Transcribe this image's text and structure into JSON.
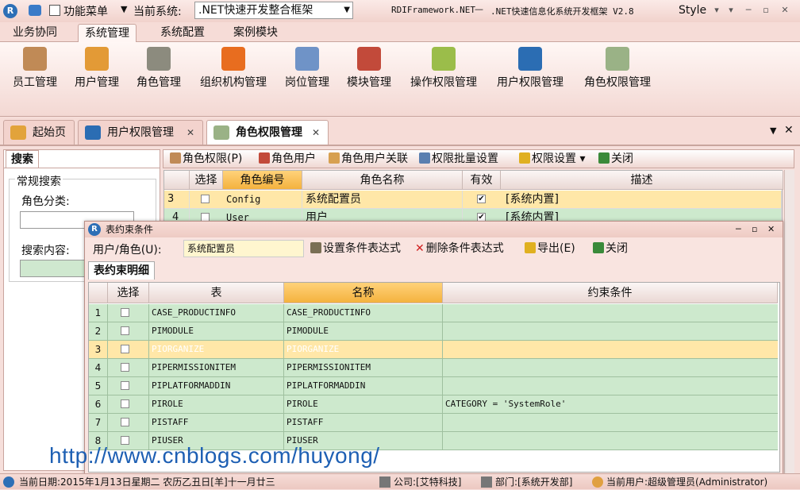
{
  "titlebar": {
    "function_menu": "功能菜单",
    "current_system_label": "当前系统:",
    "current_system_value": ".NET快速开发整合框架",
    "app_title_left": "RDIFramework.NET",
    "app_title_sep": "—",
    "app_title_right": ".NET快速信息化系统开发框架 V2.8",
    "style_label": "Style"
  },
  "ribbon_tabs": [
    "业务协同",
    "系统管理",
    "系统配置",
    "案例模块"
  ],
  "ribbon_buttons": [
    "员工管理",
    "用户管理",
    "角色管理",
    "组织机构管理",
    "岗位管理",
    "模块管理",
    "操作权限管理",
    "用户权限管理",
    "角色权限管理"
  ],
  "doc_tabs": [
    "起始页",
    "用户权限管理",
    "角色权限管理"
  ],
  "left_panel": {
    "tab": "搜索",
    "group": "常规搜索",
    "category_label": "角色分类:",
    "content_label": "搜索内容:"
  },
  "main_toolbar": [
    "角色权限(P)",
    "角色用户",
    "角色用户关联",
    "权限批量设置",
    "权限设置",
    "关闭"
  ],
  "role_grid": {
    "headers": [
      "选择",
      "角色编号",
      "角色名称",
      "有效",
      "描述"
    ],
    "rows": [
      {
        "num": "3",
        "code": "Config",
        "name": "系统配置员",
        "desc": "[系统内置]"
      },
      {
        "num": "4",
        "code": "User",
        "name": "用户",
        "desc": "[系统内置]"
      }
    ]
  },
  "dialog": {
    "title": "表约束条件",
    "user_role_label": "用户/角色(U):",
    "user_role_value": "系统配置员",
    "toolbar": [
      "设置条件表达式",
      "删除条件表达式",
      "导出(E)",
      "关闭"
    ],
    "tab": "表约束明细",
    "headers": [
      "选择",
      "表",
      "名称",
      "约束条件"
    ],
    "rows": [
      {
        "num": "1",
        "table": "CASE_PRODUCTINFO",
        "name": "CASE_PRODUCTINFO",
        "cond": ""
      },
      {
        "num": "2",
        "table": "PIMODULE",
        "name": "PIMODULE",
        "cond": ""
      },
      {
        "num": "3",
        "table": "PIORGANIZE",
        "name": "PIORGANIZE",
        "cond": ""
      },
      {
        "num": "4",
        "table": "PIPERMISSIONITEM",
        "name": "PIPERMISSIONITEM",
        "cond": ""
      },
      {
        "num": "5",
        "table": "PIPLATFORMADDIN",
        "name": "PIPLATFORMADDIN",
        "cond": ""
      },
      {
        "num": "6",
        "table": "PIROLE",
        "name": "PIROLE",
        "cond": "CATEGORY = 'SystemRole'"
      },
      {
        "num": "7",
        "table": "PISTAFF",
        "name": "PISTAFF",
        "cond": ""
      },
      {
        "num": "8",
        "table": "PIUSER",
        "name": "PIUSER",
        "cond": ""
      }
    ]
  },
  "statusbar": {
    "date": "当前日期:2015年1月13日星期二 农历乙丑日[羊]十一月廿三",
    "company": "公司:[艾特科技]",
    "dept": "部门:[系统开发部]",
    "user": "当前用户:超级管理员(Administrator)"
  },
  "watermark": "http://www.cnblogs.com/huyong/"
}
